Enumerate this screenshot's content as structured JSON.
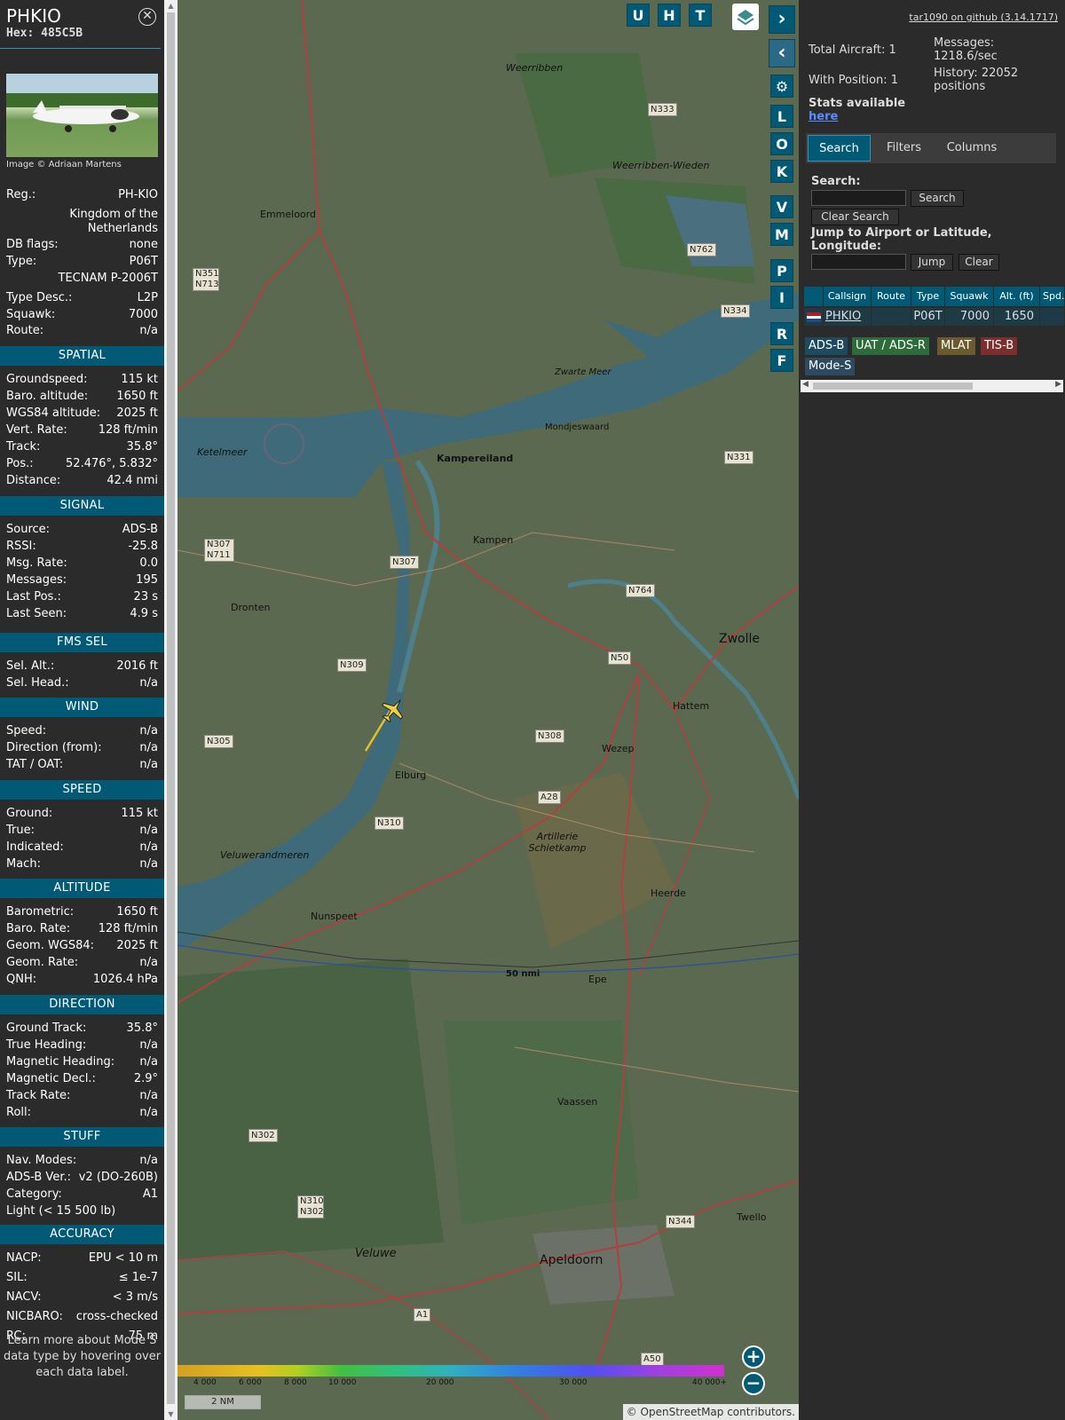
{
  "aircraft": {
    "callsign": "PHKIO",
    "hex_label": "Hex: 485C5B",
    "photo_credit": "Image © Adriaan Martens"
  },
  "details": [
    {
      "k": "Reg.:",
      "v": "PH-KIO"
    },
    {
      "k": "",
      "v": "Kingdom of the Netherlands"
    },
    {
      "k": "DB flags:",
      "v": "none"
    },
    {
      "k": "Type:",
      "v": "P06T"
    },
    {
      "k": "",
      "v": "TECNAM P-2006T"
    },
    {
      "k": "Type Desc.:",
      "v": "L2P"
    },
    {
      "k": "Squawk:",
      "v": "7000"
    },
    {
      "k": "Route:",
      "v": "n/a"
    }
  ],
  "sections": {
    "spatial": "SPATIAL",
    "signal": "SIGNAL",
    "fms": "FMS SEL",
    "wind": "WIND",
    "speed": "SPEED",
    "altitude": "ALTITUDE",
    "direction": "DIRECTION",
    "stuff": "STUFF",
    "accuracy": "ACCURACY"
  },
  "spatial": [
    {
      "k": "Groundspeed:",
      "v": "115 kt"
    },
    {
      "k": "Baro. altitude:",
      "v": "1650 ft"
    },
    {
      "k": "WGS84 altitude:",
      "v": "2025 ft"
    },
    {
      "k": "Vert. Rate:",
      "v": "128 ft/min"
    },
    {
      "k": "Track:",
      "v": "35.8°"
    },
    {
      "k": "Pos.:",
      "v": "52.476°, 5.832°"
    },
    {
      "k": "Distance:",
      "v": "42.4 nmi"
    }
  ],
  "signal": [
    {
      "k": "Source:",
      "v": "ADS-B"
    },
    {
      "k": "RSSI:",
      "v": "-25.8"
    },
    {
      "k": "Msg. Rate:",
      "v": "0.0"
    },
    {
      "k": "Messages:",
      "v": "195"
    },
    {
      "k": "Last Pos.:",
      "v": "23 s"
    },
    {
      "k": "Last Seen:",
      "v": "4.9 s"
    }
  ],
  "fms": [
    {
      "k": "Sel. Alt.:",
      "v": "2016 ft"
    },
    {
      "k": "Sel. Head.:",
      "v": "n/a"
    }
  ],
  "wind": [
    {
      "k": "Speed:",
      "v": "n/a"
    },
    {
      "k": "Direction (from):",
      "v": "n/a"
    },
    {
      "k": "TAT / OAT:",
      "v": "n/a"
    }
  ],
  "speed": [
    {
      "k": "Ground:",
      "v": "115 kt"
    },
    {
      "k": "True:",
      "v": "n/a"
    },
    {
      "k": "Indicated:",
      "v": "n/a"
    },
    {
      "k": "Mach:",
      "v": "n/a"
    }
  ],
  "altitude": [
    {
      "k": "Barometric:",
      "v": "1650 ft"
    },
    {
      "k": "Baro. Rate:",
      "v": "128 ft/min"
    },
    {
      "k": "Geom. WGS84:",
      "v": "2025 ft"
    },
    {
      "k": "Geom. Rate:",
      "v": "n/a"
    },
    {
      "k": "QNH:",
      "v": "1026.4 hPa"
    }
  ],
  "direction": [
    {
      "k": "Ground Track:",
      "v": "35.8°"
    },
    {
      "k": "True Heading:",
      "v": "n/a"
    },
    {
      "k": "Magnetic Heading:",
      "v": "n/a"
    },
    {
      "k": "Magnetic Decl.:",
      "v": "2.9°"
    },
    {
      "k": "Track Rate:",
      "v": "n/a"
    },
    {
      "k": "Roll:",
      "v": "n/a"
    }
  ],
  "stuff": [
    {
      "k": "Nav. Modes:",
      "v": "n/a"
    },
    {
      "k": "ADS-B Ver.:",
      "v": "v2 (DO-260B)"
    },
    {
      "k": "Category:",
      "v": "A1"
    },
    {
      "k": "Light (< 15 500 lb)",
      "v": ""
    }
  ],
  "accuracy": [
    {
      "k": "NACP:",
      "v": "EPU < 10 m"
    },
    {
      "k": "SIL:",
      "v": "≤ 1e-7"
    },
    {
      "k": "NACV:",
      "v": "< 3 m/s"
    },
    {
      "k": "NICBARO:",
      "v": "cross-checked"
    },
    {
      "k": "RC:",
      "v": "75 m"
    }
  ],
  "note": "Learn more about Mode S data type by hovering over each data label.",
  "map": {
    "buttons_top": [
      "U",
      "H",
      "T"
    ],
    "buttons_side": [
      "L",
      "O",
      "K",
      "V",
      "M",
      "P",
      "I",
      "R",
      "F"
    ],
    "places": [
      "Emmeloord",
      "Kampereiland",
      "Kampen",
      "Dronten",
      "Zwolle",
      "Hattem",
      "Wezep",
      "Elburg",
      "Heerde",
      "Nunspeet",
      "Epe",
      "Vaassen",
      "Apeldoorn",
      "Twello",
      "Veluwe",
      "Mondjeswaard",
      "Weerribben",
      "Weerribben-Wieden",
      "Ketelmeer",
      "Zwarte Meer",
      "Artillerie Schietkamp",
      "Veluwerandmeren"
    ],
    "roads": [
      "N333",
      "N762",
      "N334",
      "N351 N713",
      "N331",
      "N307 N711",
      "N307",
      "N764",
      "N309",
      "N50",
      "N305",
      "N308",
      "A28",
      "N310",
      "N302",
      "N310 N302",
      "N344",
      "A1",
      "A50"
    ],
    "ring_label": "50 nmi",
    "scale_ticks": [
      "4 000",
      "6 000",
      "8 000",
      "10 000",
      "20 000",
      "30 000",
      "40 000+"
    ],
    "scale_label": "2 NM",
    "attribution": "© OpenStreetMap contributors."
  },
  "panel": {
    "github": "tar1090 on github (3.14.1717)",
    "total_aircraft": "Total Aircraft: 1",
    "with_position": "With Position: 1",
    "messages": "Messages: 1218.6/sec",
    "history": "History: 22052 positions",
    "stats_text": "Stats available",
    "stats_link": "here",
    "tabs": [
      "Search",
      "Filters",
      "Columns"
    ],
    "search_label": "Search:",
    "search_btn": "Search",
    "clear_search_btn": "Clear Search",
    "jump_label": "Jump to Airport or Latitude, Longitude:",
    "jump_btn": "Jump",
    "clear_btn": "Clear",
    "columns": [
      "Callsign",
      "Route",
      "Type",
      "Squawk",
      "Alt. (ft)",
      "Spd."
    ],
    "row": {
      "callsign": "PHKIO",
      "route": "",
      "type": "P06T",
      "squawk": "7000",
      "alt": "1650"
    },
    "legend": [
      {
        "label": "ADS-B",
        "color": "#1e4a5e"
      },
      {
        "label": "UAT / ADS-R",
        "color": "#2e6b3a"
      },
      {
        "label": "MLAT",
        "color": "#6b5a2e"
      },
      {
        "label": "TIS-B",
        "color": "#7a2e2e"
      },
      {
        "label": "Mode-S",
        "color": "#2e4a5e"
      }
    ]
  }
}
